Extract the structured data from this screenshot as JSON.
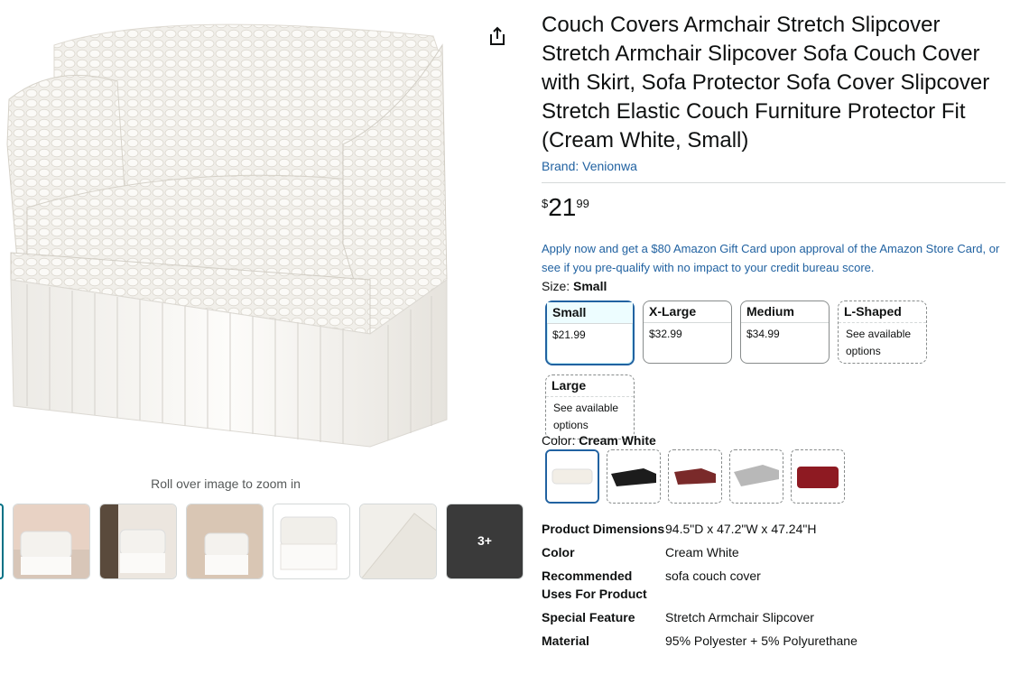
{
  "product": {
    "title": "Couch Covers Armchair Stretch Slipcover Stretch Armchair Slipcover Sofa Couch Cover with Skirt, Sofa Protector Sofa Cover Slipcover Stretch Elastic Couch Furniture Protector Fit (Cream White, Small)",
    "brand": "Brand: Venionwa",
    "price": {
      "symbol": "$",
      "whole": "21",
      "fraction": "99"
    },
    "promo": "Apply now and get a $80 Amazon Gift Card upon approval of the Amazon Store Card, or see if you pre-qualify with no impact to your credit bureau score."
  },
  "gallery": {
    "zoom_hint": "Roll over image to zoom in",
    "more_label": "3+"
  },
  "size": {
    "label": "Size: ",
    "selected": "Small",
    "options": [
      {
        "name": "Small",
        "value": "$21.99"
      },
      {
        "name": "X-Large",
        "value": "$32.99"
      },
      {
        "name": "Medium",
        "value": "$34.99"
      },
      {
        "name": "L-Shaped",
        "value": "See available options"
      },
      {
        "name": "Large",
        "value": "See available options"
      }
    ]
  },
  "color": {
    "label": "Color: ",
    "selected": "Cream White",
    "swatch_colors": [
      "#f2eee6",
      "#1c1c1c",
      "#7a2a2a",
      "#b8b8b8",
      "#8e1a22"
    ]
  },
  "specs": [
    {
      "key": "Product Dimensions",
      "value": "94.5\"D x 47.2\"W x 47.24\"H"
    },
    {
      "key": "Color",
      "value": "Cream White"
    },
    {
      "key": "Recommended Uses For Product",
      "value": "sofa couch cover"
    },
    {
      "key": "Special Feature",
      "value": "Stretch Armchair Slipcover"
    },
    {
      "key": "Material",
      "value": "95% Polyester + 5% Polyurethane"
    }
  ],
  "colors": {
    "link": "#2162a1",
    "selected_border": "#2162a1"
  },
  "icons": {
    "share": "share-icon"
  }
}
